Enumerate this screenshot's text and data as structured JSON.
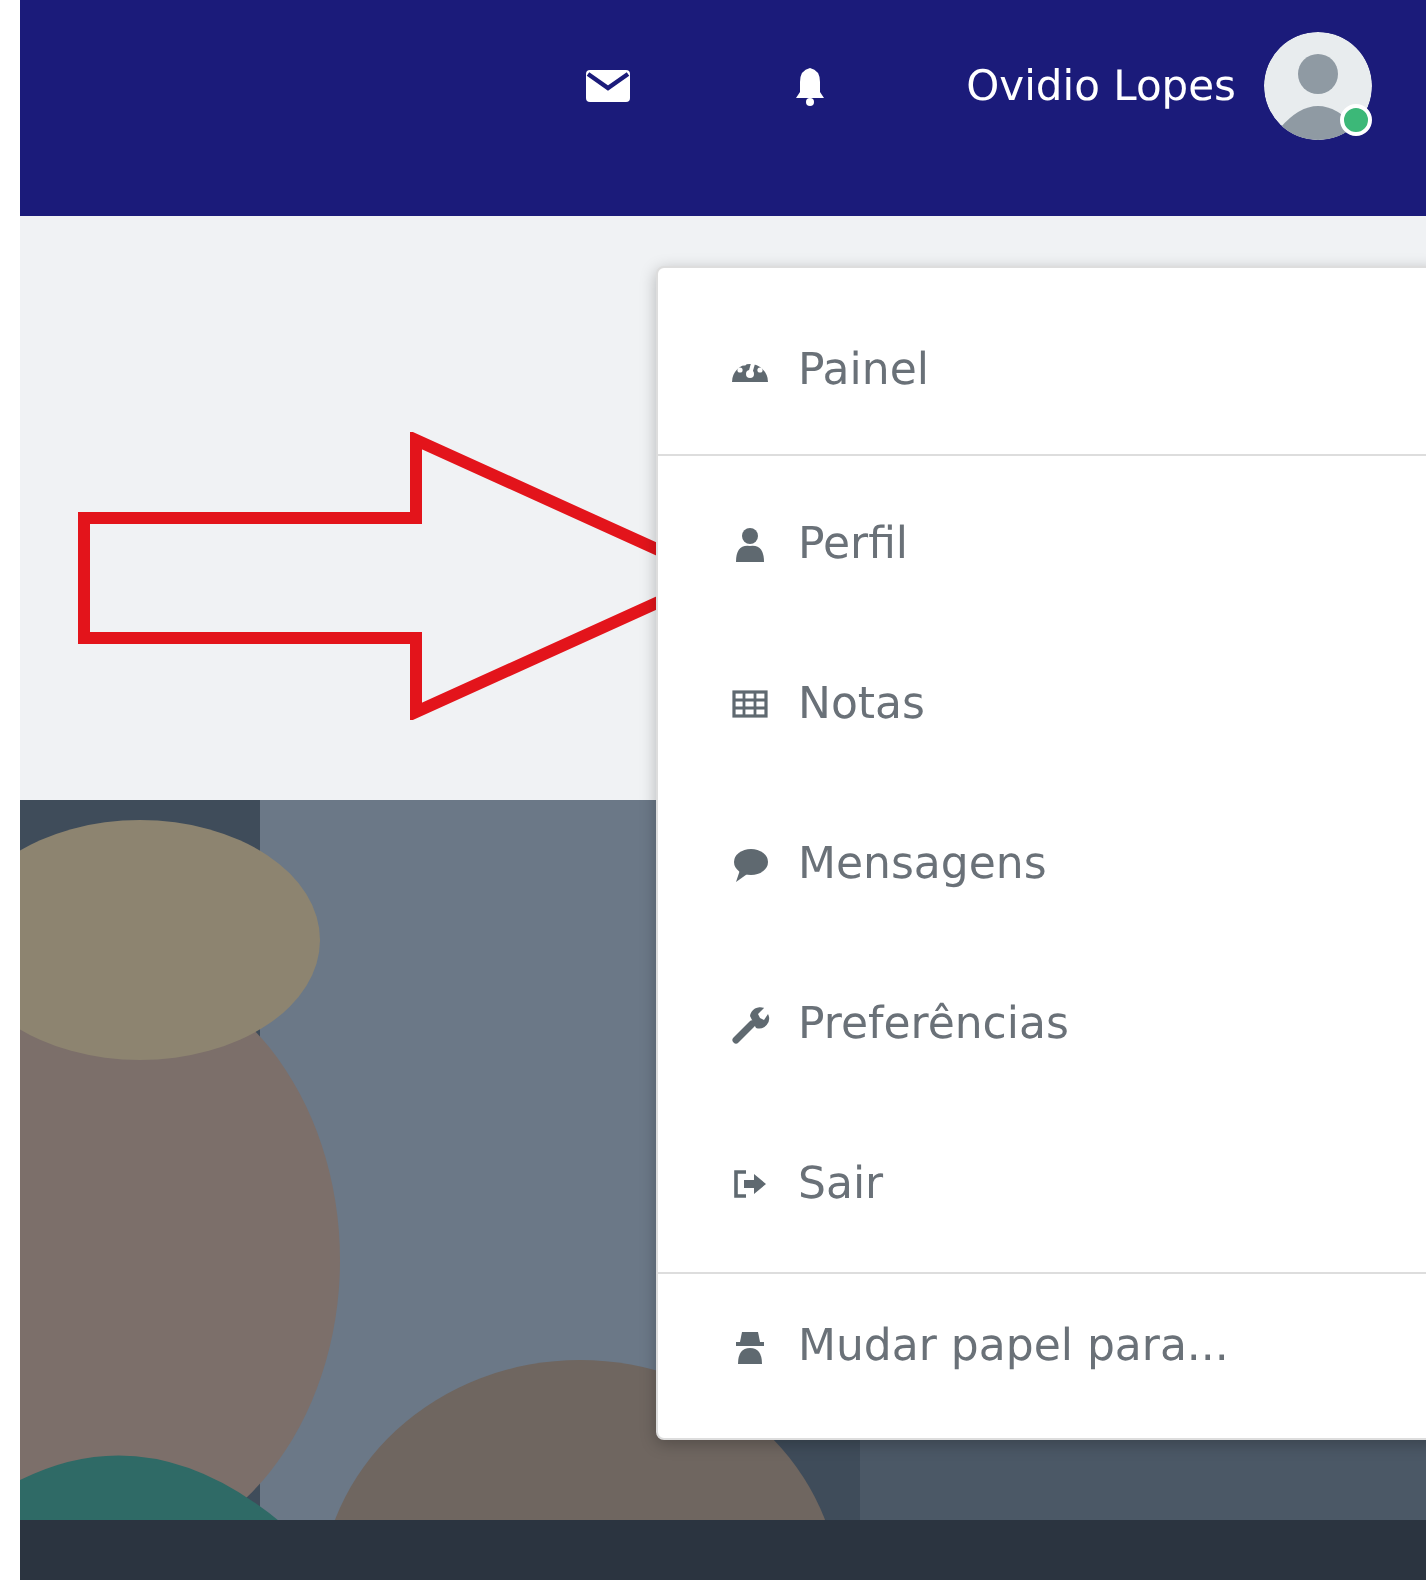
{
  "navbar": {
    "user_name": "Ovidio Lopes",
    "online": true
  },
  "user_menu": {
    "groups": [
      [
        {
          "label": "Painel"
        }
      ],
      [
        {
          "label": "Perfil"
        },
        {
          "label": "Notas"
        },
        {
          "label": "Mensagens"
        },
        {
          "label": "Preferências"
        },
        {
          "label": "Sair"
        }
      ],
      [
        {
          "label": "Mudar papel para..."
        }
      ]
    ]
  }
}
